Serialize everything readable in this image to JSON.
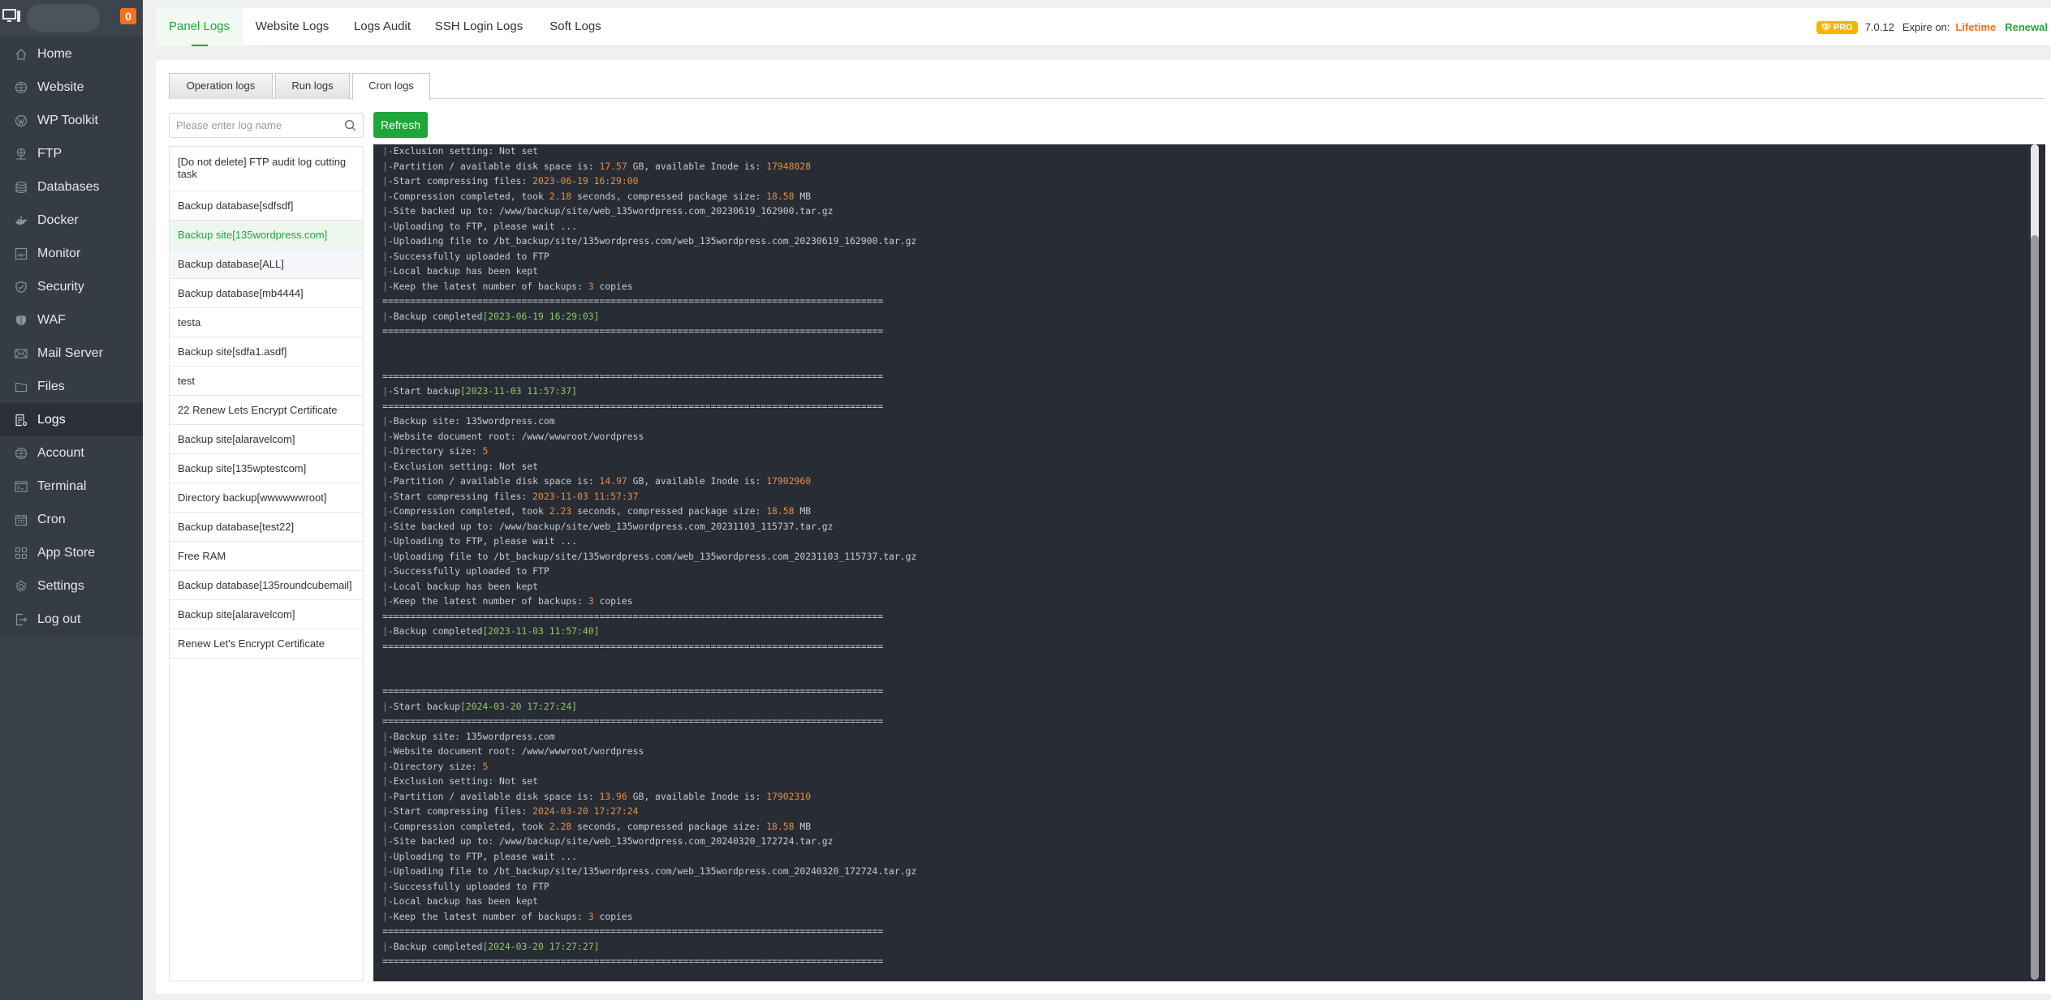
{
  "sidebar": {
    "alert_count": "0",
    "items": [
      {
        "label": "Home",
        "icon": "home-icon"
      },
      {
        "label": "Website",
        "icon": "globe-icon"
      },
      {
        "label": "WP Toolkit",
        "icon": "wordpress-icon"
      },
      {
        "label": "FTP",
        "icon": "ftp-icon"
      },
      {
        "label": "Databases",
        "icon": "database-icon"
      },
      {
        "label": "Docker",
        "icon": "docker-icon"
      },
      {
        "label": "Monitor",
        "icon": "monitor-icon"
      },
      {
        "label": "Security",
        "icon": "shield-icon"
      },
      {
        "label": "WAF",
        "icon": "waf-shield-icon"
      },
      {
        "label": "Mail Server",
        "icon": "mail-icon"
      },
      {
        "label": "Files",
        "icon": "folder-icon"
      },
      {
        "label": "Logs",
        "icon": "logs-icon",
        "active": true
      },
      {
        "label": "Account",
        "icon": "account-icon"
      },
      {
        "label": "Terminal",
        "icon": "terminal-icon"
      },
      {
        "label": "Cron",
        "icon": "calendar-icon"
      },
      {
        "label": "App Store",
        "icon": "grid-icon"
      },
      {
        "label": "Settings",
        "icon": "gear-icon"
      },
      {
        "label": "Log out",
        "icon": "logout-icon"
      }
    ]
  },
  "topbar": {
    "tabs": [
      {
        "label": "Panel Logs",
        "active": true
      },
      {
        "label": "Website Logs"
      },
      {
        "label": "Logs Audit"
      },
      {
        "label": "SSH Login Logs"
      },
      {
        "label": "Soft Logs"
      }
    ],
    "pro_label": "PRO",
    "version": "7.0.12",
    "expire_label": "Expire on:",
    "expire_value": "Lifetime",
    "renewal_label": "Renewal"
  },
  "subtabs": [
    {
      "label": "Operation logs"
    },
    {
      "label": "Run logs"
    },
    {
      "label": "Cron logs",
      "active": true
    }
  ],
  "search": {
    "placeholder": "Please enter log name",
    "value": ""
  },
  "refresh_label": "Refresh",
  "log_list": [
    "[Do not delete] FTP audit log cutting task",
    "Backup database[sdfsdf]",
    "Backup site[135wordpress.com]",
    "Backup database[ALL]",
    "Backup database[mb4444]",
    "testa",
    "Backup site[sdfa1.asdf]",
    "test",
    "22 Renew Lets Encrypt Certificate",
    "Backup site[alaravelcom]",
    "Backup site[135wptestcom]",
    "Directory backup[wwwwwwroot]",
    "Backup database[test22]",
    "Free RAM",
    "Backup database[135roundcubemail]",
    "Backup site[alaravelcom]",
    "Renew Let's Encrypt Certificate"
  ],
  "selected_log": "Backup site[135wordpress.com]",
  "console": {
    "separator": "==========================================================================================",
    "partial_first_block": {
      "exclusion": "Not set",
      "disk_space": "17.57",
      "inode": "17948828",
      "compress_start": "2023-06-19 16:29:00",
      "took": "2.18",
      "package_size": "18.58",
      "local_path": "/www/backup/site/web_135wordpress.com_20230619_162900.tar.gz",
      "remote_path": "/bt_backup/site/135wordpress.com/web_135wordpress.com_20230619_162900.tar.gz",
      "keep": "3",
      "completed": "2023-06-19 16:29:03"
    },
    "blocks": [
      {
        "start": "2023-11-03 11:57:37",
        "site": "135wordpress.com",
        "doc_root": "/www/wwwroot/wordpress",
        "dir_size": "5",
        "exclusion": "Not set",
        "disk_space": "14.97",
        "inode": "17902960",
        "compress_start": "2023-11-03 11:57:37",
        "took": "2.23",
        "package_size": "18.58",
        "local_path": "/www/backup/site/web_135wordpress.com_20231103_115737.tar.gz",
        "remote_path": "/bt_backup/site/135wordpress.com/web_135wordpress.com_20231103_115737.tar.gz",
        "keep": "3",
        "completed": "2023-11-03 11:57:40"
      },
      {
        "start": "2024-03-20 17:27:24",
        "site": "135wordpress.com",
        "doc_root": "/www/wwwroot/wordpress",
        "dir_size": "5",
        "exclusion": "Not set",
        "disk_space": "13.96",
        "inode": "17902310",
        "compress_start": "2024-03-20 17:27:24",
        "took": "2.28",
        "package_size": "18.58",
        "local_path": "/www/backup/site/web_135wordpress.com_20240320_172724.tar.gz",
        "remote_path": "/bt_backup/site/135wordpress.com/web_135wordpress.com_20240320_172724.tar.gz",
        "keep": "3",
        "completed": "2024-03-20 17:27:27"
      }
    ],
    "text": {
      "start_backup": "-Start backup",
      "backup_site": "-Backup site: ",
      "doc_root": "-Website document root: ",
      "dir_size": "-Directory size: ",
      "exclusion": "-Exclusion setting: ",
      "partition": "-Partition / available disk space is: ",
      "gb_inode": " GB, available Inode is: ",
      "compress_start": "-Start compressing files: ",
      "compress_done": "-Compression completed, took ",
      "seconds_pkg": " seconds, compressed package size: ",
      "mb": " MB",
      "backed_up": "-Site backed up to: ",
      "uploading_ftp": "-Uploading to FTP, please wait ...",
      "uploading_file": "-Uploading file to ",
      "uploaded": "-Successfully uploaded to FTP",
      "local_kept": "-Local backup has been kept",
      "keep_latest": "-Keep the latest number of backups: ",
      "copies": " copies",
      "completed": "-Backup completed"
    }
  },
  "colors": {
    "accent": "#20a53a",
    "number": "#e0904a",
    "timestamp": "#8fc76a",
    "alert": "#f4711d",
    "pro": "#ffb300"
  }
}
